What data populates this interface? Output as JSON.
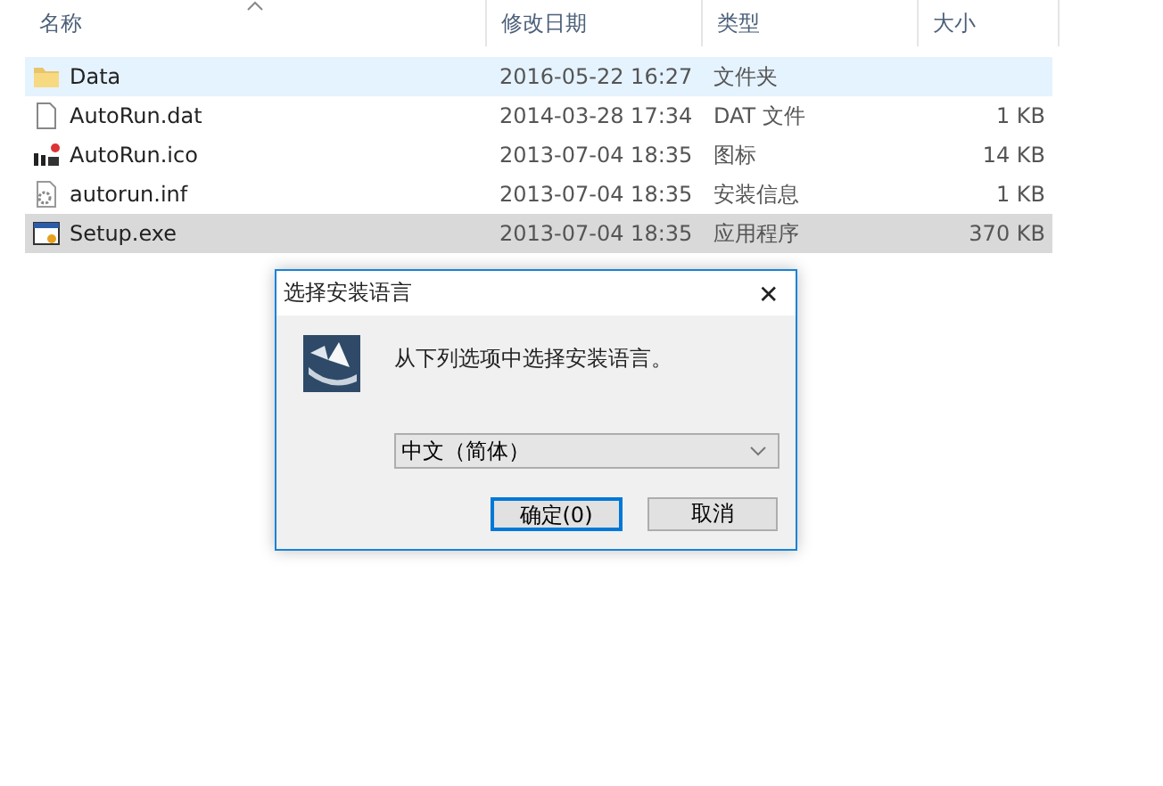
{
  "file_list": {
    "columns": [
      {
        "label": "名称",
        "sorted": true
      },
      {
        "label": "修改日期",
        "sorted": false
      },
      {
        "label": "类型",
        "sorted": false
      },
      {
        "label": "大小",
        "sorted": false
      }
    ],
    "rows": [
      {
        "kind": "folder",
        "name": "Data",
        "date": "2016-05-22 16:27",
        "type": "文件夹",
        "size": "",
        "hovered": true,
        "selected": false
      },
      {
        "kind": "file",
        "name": "AutoRun.dat",
        "date": "2014-03-28 17:34",
        "type": "DAT 文件",
        "size": "1 KB",
        "hovered": false,
        "selected": false
      },
      {
        "kind": "icon",
        "name": "AutoRun.ico",
        "date": "2013-07-04 18:35",
        "type": "图标",
        "size": "14 KB",
        "hovered": false,
        "selected": false
      },
      {
        "kind": "settings",
        "name": "autorun.inf",
        "date": "2013-07-04 18:35",
        "type": "安装信息",
        "size": "1 KB",
        "hovered": false,
        "selected": false
      },
      {
        "kind": "app",
        "name": "Setup.exe",
        "date": "2013-07-04 18:35",
        "type": "应用程序",
        "size": "370 KB",
        "hovered": false,
        "selected": true
      }
    ]
  },
  "dialog": {
    "title": "选择安装语言",
    "close": "✕",
    "message": "从下列选项中选择安装语言。",
    "language": {
      "value": "中文（简体）"
    },
    "buttons": [
      {
        "label": "确定(0)",
        "default": true
      },
      {
        "label": "取消",
        "default": false
      }
    ]
  }
}
